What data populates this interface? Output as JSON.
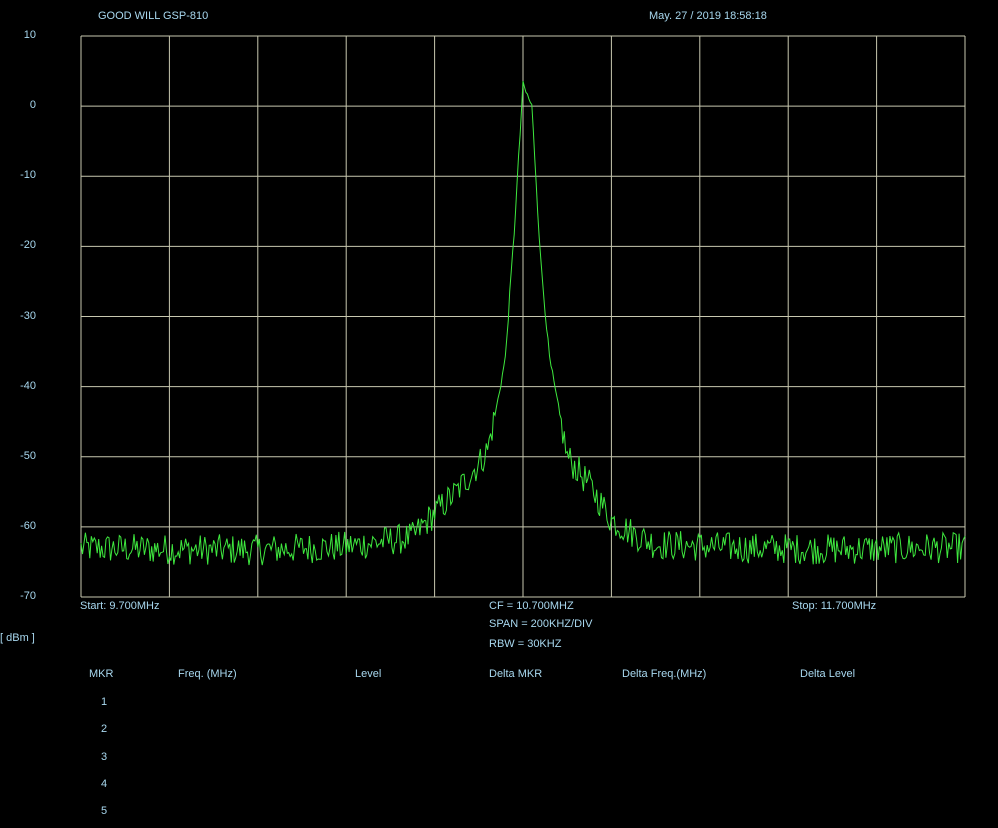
{
  "header": {
    "instrument": "GOOD WILL GSP-810",
    "timestamp": "May. 27 / 2019  18:58:18"
  },
  "footer": {
    "start": "Start:  9.700MHz",
    "stop": "Stop:  11.700MHz",
    "cf": "CF = 10.700MHZ",
    "span": "SPAN = 200KHZ/DIV",
    "rbw": "RBW = 30KHZ",
    "unit": "[ dBm ]"
  },
  "marker_table": {
    "headers": [
      "MKR",
      "Freq. (MHz)",
      "Level",
      "Delta MKR",
      "Delta Freq.(MHz)",
      "Delta Level"
    ],
    "rows": [
      "1",
      "2",
      "3",
      "4",
      "5"
    ]
  },
  "colors": {
    "trace": "#3ee83e",
    "grid": "#c8c8b0",
    "text": "#a8d8ef"
  },
  "chart_data": {
    "type": "line",
    "xlabel": "",
    "ylabel": "[ dBm ]",
    "xlim": [
      9.7,
      11.7
    ],
    "ylim": [
      -70,
      10
    ],
    "yticks": [
      "10",
      "0",
      "-10",
      "-20",
      "-30",
      "-40",
      "-50",
      "-60",
      "-70"
    ],
    "grid": true,
    "series": [
      {
        "x": [
          9.7,
          9.9,
          10.1,
          10.3,
          10.45,
          10.5,
          10.55,
          10.6,
          10.62,
          10.64,
          10.66,
          10.68,
          10.7,
          10.72,
          10.74,
          10.76,
          10.78,
          10.8,
          10.85,
          10.9,
          10.95,
          11.0,
          11.2,
          11.4,
          11.6,
          11.7
        ],
        "values": [
          -63,
          -63.2,
          -63.3,
          -62.8,
          -61.5,
          -58,
          -55,
          -51,
          -49,
          -43,
          -36,
          -18,
          3,
          0,
          -22,
          -36,
          -43,
          -50,
          -54,
          -59,
          -61,
          -62.5,
          -63,
          -63.2,
          -63,
          -63
        ]
      }
    ]
  }
}
